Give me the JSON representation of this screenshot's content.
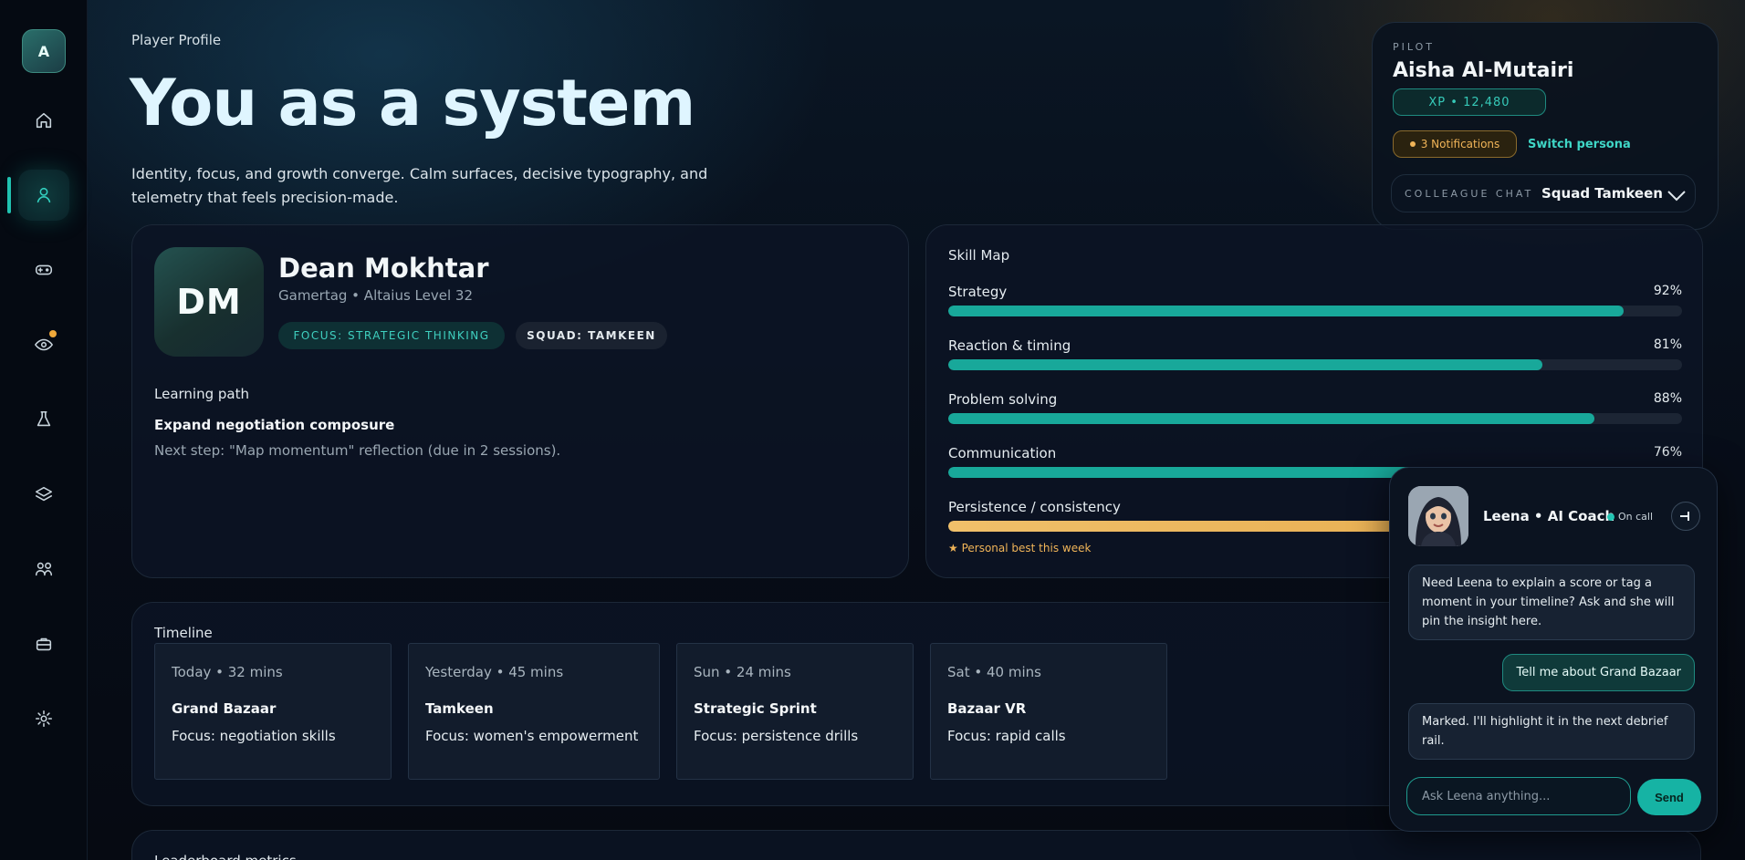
{
  "sidebar": {
    "avatar_initial": "A",
    "items": [
      {
        "name": "home-icon"
      },
      {
        "name": "user-icon"
      },
      {
        "name": "gamepad-icon"
      },
      {
        "name": "eye-icon"
      },
      {
        "name": "flask-icon"
      },
      {
        "name": "layers-icon"
      },
      {
        "name": "users-icon"
      },
      {
        "name": "briefcase-icon"
      },
      {
        "name": "gear-icon"
      }
    ],
    "active_item": "user-icon",
    "notification_dot_item": "eye-icon"
  },
  "header": {
    "eyebrow": "Player Profile",
    "title": "You as a system",
    "subtitle": "Identity, focus, and growth converge. Calm surfaces, decisive typography, and telemetry that feels precision-made."
  },
  "pilot": {
    "label": "PILOT",
    "name": "Aisha Al-Mutairi",
    "xp": "XP • 12,480",
    "notifications": "3 Notifications",
    "switch_label": "Switch persona",
    "chat_label": "COLLEAGUE CHAT",
    "chat_value": "Squad Tamkeen"
  },
  "profile": {
    "initials": "DM",
    "name": "Dean Mokhtar",
    "tagline": "Gamertag • Altaius Level 32",
    "focus_chip": "FOCUS: STRATEGIC THINKING",
    "squad_chip": "SQUAD: TAMKEEN",
    "learning_path_heading": "Learning path",
    "learning_path_title": "Expand negotiation composure",
    "learning_path_next": "Next step: \"Map momentum\" reflection (due in 2 sessions)."
  },
  "skills": {
    "heading": "Skill Map",
    "items": [
      {
        "name": "Strategy",
        "percent_label": "92%",
        "value": 92
      },
      {
        "name": "Reaction & timing",
        "percent_label": "81%",
        "value": 81
      },
      {
        "name": "Problem solving",
        "percent_label": "88%",
        "value": 88
      },
      {
        "name": "Communication",
        "percent_label": "76%",
        "value": 76
      },
      {
        "name": "Persistence / consistency",
        "percent_label": "",
        "value": 94
      }
    ],
    "personal_best_note": "★ Personal best this week"
  },
  "timeline": {
    "heading": "Timeline",
    "items": [
      {
        "when": "Today • 32 mins",
        "title": "Grand Bazaar",
        "focus": "Focus: negotiation skills"
      },
      {
        "when": "Yesterday • 45 mins",
        "title": "Tamkeen",
        "focus": "Focus: women's empowerment"
      },
      {
        "when": "Sun • 24 mins",
        "title": "Strategic Sprint",
        "focus": "Focus: persistence drills"
      },
      {
        "when": "Sat • 40 mins",
        "title": "Bazaar VR",
        "focus": "Focus: rapid calls"
      }
    ]
  },
  "leaderboard": {
    "heading": "Leaderboard metrics"
  },
  "coach": {
    "name": "Leena • AI Coach",
    "status": "On call",
    "messages": [
      {
        "from": "bot",
        "text": "Need Leena to explain a score or tag a moment in your timeline? Ask and she will pin the insight here."
      },
      {
        "from": "me",
        "text": "Tell me about Grand Bazaar"
      },
      {
        "from": "bot",
        "text": "Marked. I'll highlight it in the next debrief rail."
      }
    ],
    "input_placeholder": "Ask Leena anything...",
    "send_label": "Send"
  },
  "colors": {
    "accent_teal": "#18a89a",
    "accent_gold": "#f0b458",
    "background": "#060b14"
  }
}
